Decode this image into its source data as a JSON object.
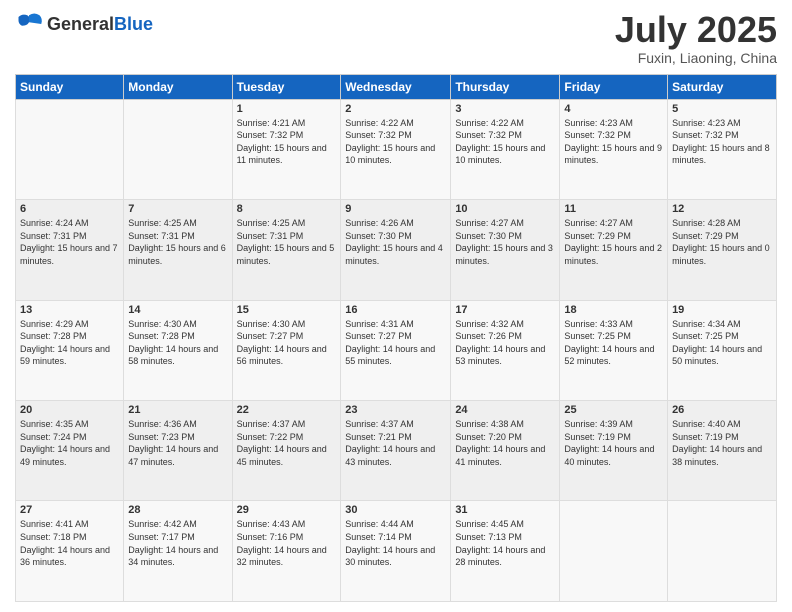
{
  "logo": {
    "general": "General",
    "blue": "Blue"
  },
  "title": {
    "month_year": "July 2025",
    "location": "Fuxin, Liaoning, China"
  },
  "days_of_week": [
    "Sunday",
    "Monday",
    "Tuesday",
    "Wednesday",
    "Thursday",
    "Friday",
    "Saturday"
  ],
  "weeks": [
    [
      {
        "day": "",
        "info": ""
      },
      {
        "day": "",
        "info": ""
      },
      {
        "day": "1",
        "info": "Sunrise: 4:21 AM\nSunset: 7:32 PM\nDaylight: 15 hours and 11 minutes."
      },
      {
        "day": "2",
        "info": "Sunrise: 4:22 AM\nSunset: 7:32 PM\nDaylight: 15 hours and 10 minutes."
      },
      {
        "day": "3",
        "info": "Sunrise: 4:22 AM\nSunset: 7:32 PM\nDaylight: 15 hours and 10 minutes."
      },
      {
        "day": "4",
        "info": "Sunrise: 4:23 AM\nSunset: 7:32 PM\nDaylight: 15 hours and 9 minutes."
      },
      {
        "day": "5",
        "info": "Sunrise: 4:23 AM\nSunset: 7:32 PM\nDaylight: 15 hours and 8 minutes."
      }
    ],
    [
      {
        "day": "6",
        "info": "Sunrise: 4:24 AM\nSunset: 7:31 PM\nDaylight: 15 hours and 7 minutes."
      },
      {
        "day": "7",
        "info": "Sunrise: 4:25 AM\nSunset: 7:31 PM\nDaylight: 15 hours and 6 minutes."
      },
      {
        "day": "8",
        "info": "Sunrise: 4:25 AM\nSunset: 7:31 PM\nDaylight: 15 hours and 5 minutes."
      },
      {
        "day": "9",
        "info": "Sunrise: 4:26 AM\nSunset: 7:30 PM\nDaylight: 15 hours and 4 minutes."
      },
      {
        "day": "10",
        "info": "Sunrise: 4:27 AM\nSunset: 7:30 PM\nDaylight: 15 hours and 3 minutes."
      },
      {
        "day": "11",
        "info": "Sunrise: 4:27 AM\nSunset: 7:29 PM\nDaylight: 15 hours and 2 minutes."
      },
      {
        "day": "12",
        "info": "Sunrise: 4:28 AM\nSunset: 7:29 PM\nDaylight: 15 hours and 0 minutes."
      }
    ],
    [
      {
        "day": "13",
        "info": "Sunrise: 4:29 AM\nSunset: 7:28 PM\nDaylight: 14 hours and 59 minutes."
      },
      {
        "day": "14",
        "info": "Sunrise: 4:30 AM\nSunset: 7:28 PM\nDaylight: 14 hours and 58 minutes."
      },
      {
        "day": "15",
        "info": "Sunrise: 4:30 AM\nSunset: 7:27 PM\nDaylight: 14 hours and 56 minutes."
      },
      {
        "day": "16",
        "info": "Sunrise: 4:31 AM\nSunset: 7:27 PM\nDaylight: 14 hours and 55 minutes."
      },
      {
        "day": "17",
        "info": "Sunrise: 4:32 AM\nSunset: 7:26 PM\nDaylight: 14 hours and 53 minutes."
      },
      {
        "day": "18",
        "info": "Sunrise: 4:33 AM\nSunset: 7:25 PM\nDaylight: 14 hours and 52 minutes."
      },
      {
        "day": "19",
        "info": "Sunrise: 4:34 AM\nSunset: 7:25 PM\nDaylight: 14 hours and 50 minutes."
      }
    ],
    [
      {
        "day": "20",
        "info": "Sunrise: 4:35 AM\nSunset: 7:24 PM\nDaylight: 14 hours and 49 minutes."
      },
      {
        "day": "21",
        "info": "Sunrise: 4:36 AM\nSunset: 7:23 PM\nDaylight: 14 hours and 47 minutes."
      },
      {
        "day": "22",
        "info": "Sunrise: 4:37 AM\nSunset: 7:22 PM\nDaylight: 14 hours and 45 minutes."
      },
      {
        "day": "23",
        "info": "Sunrise: 4:37 AM\nSunset: 7:21 PM\nDaylight: 14 hours and 43 minutes."
      },
      {
        "day": "24",
        "info": "Sunrise: 4:38 AM\nSunset: 7:20 PM\nDaylight: 14 hours and 41 minutes."
      },
      {
        "day": "25",
        "info": "Sunrise: 4:39 AM\nSunset: 7:19 PM\nDaylight: 14 hours and 40 minutes."
      },
      {
        "day": "26",
        "info": "Sunrise: 4:40 AM\nSunset: 7:19 PM\nDaylight: 14 hours and 38 minutes."
      }
    ],
    [
      {
        "day": "27",
        "info": "Sunrise: 4:41 AM\nSunset: 7:18 PM\nDaylight: 14 hours and 36 minutes."
      },
      {
        "day": "28",
        "info": "Sunrise: 4:42 AM\nSunset: 7:17 PM\nDaylight: 14 hours and 34 minutes."
      },
      {
        "day": "29",
        "info": "Sunrise: 4:43 AM\nSunset: 7:16 PM\nDaylight: 14 hours and 32 minutes."
      },
      {
        "day": "30",
        "info": "Sunrise: 4:44 AM\nSunset: 7:14 PM\nDaylight: 14 hours and 30 minutes."
      },
      {
        "day": "31",
        "info": "Sunrise: 4:45 AM\nSunset: 7:13 PM\nDaylight: 14 hours and 28 minutes."
      },
      {
        "day": "",
        "info": ""
      },
      {
        "day": "",
        "info": ""
      }
    ]
  ]
}
